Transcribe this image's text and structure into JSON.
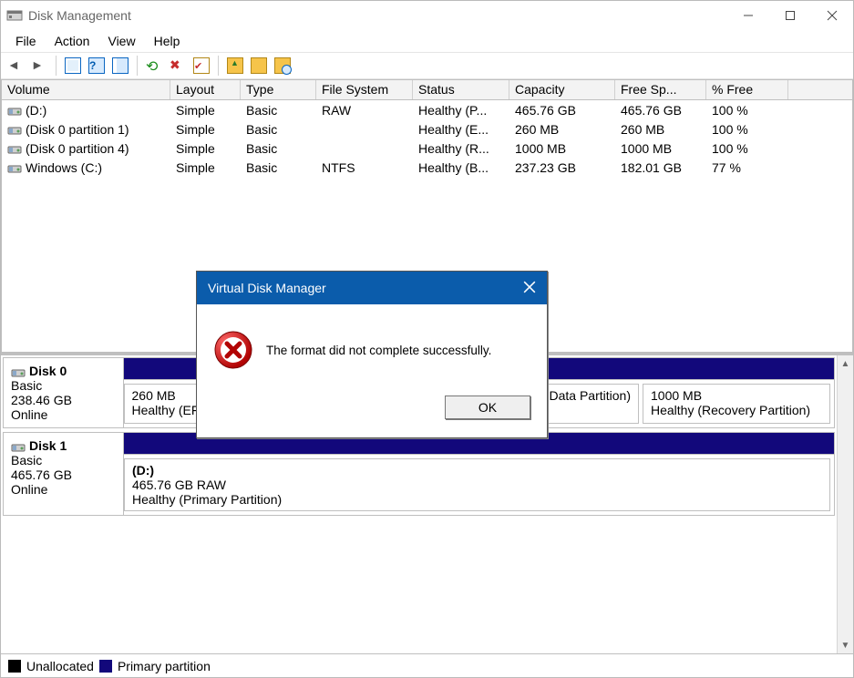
{
  "titlebar": {
    "title": "Disk Management"
  },
  "menu": {
    "items": [
      "File",
      "Action",
      "View",
      "Help"
    ]
  },
  "columns": {
    "volume": "Volume",
    "layout": "Layout",
    "type": "Type",
    "fs": "File System",
    "status": "Status",
    "capacity": "Capacity",
    "free": "Free Sp...",
    "pfree": "% Free"
  },
  "volumes": [
    {
      "name": "(D:)",
      "layout": "Simple",
      "type": "Basic",
      "fs": "RAW",
      "status": "Healthy (P...",
      "capacity": "465.76 GB",
      "free": "465.76 GB",
      "pfree": "100 %"
    },
    {
      "name": "(Disk 0 partition 1)",
      "layout": "Simple",
      "type": "Basic",
      "fs": "",
      "status": "Healthy (E...",
      "capacity": "260 MB",
      "free": "260 MB",
      "pfree": "100 %"
    },
    {
      "name": "(Disk 0 partition 4)",
      "layout": "Simple",
      "type": "Basic",
      "fs": "",
      "status": "Healthy (R...",
      "capacity": "1000 MB",
      "free": "1000 MB",
      "pfree": "100 %"
    },
    {
      "name": "Windows (C:)",
      "layout": "Simple",
      "type": "Basic",
      "fs": "NTFS",
      "status": "Healthy (B...",
      "capacity": "237.23 GB",
      "free": "182.01 GB",
      "pfree": "77 %"
    }
  ],
  "disks": [
    {
      "name": "Disk 0",
      "type": "Basic",
      "size": "238.46 GB",
      "state": "Online",
      "parts": [
        {
          "title": "",
          "line1": "260 MB",
          "line2": "Healthy (EFI System Partition)",
          "flex": "0 0 170px"
        },
        {
          "title": "",
          "line1": "",
          "line2": "Healthy (Boot, Page File, Crash Dump, Basic Data Partition)",
          "flex": "1"
        },
        {
          "title": "",
          "line1": "1000 MB",
          "line2": "Healthy (Recovery Partition)",
          "flex": "0 0 206px"
        }
      ]
    },
    {
      "name": "Disk 1",
      "type": "Basic",
      "size": "465.76 GB",
      "state": "Online",
      "parts": [
        {
          "title": "(D:)",
          "line1": "465.76 GB RAW",
          "line2": "Healthy (Primary Partition)",
          "flex": "1"
        }
      ]
    }
  ],
  "legend": {
    "unallocated": "Unallocated",
    "primary": "Primary partition"
  },
  "dialog": {
    "title": "Virtual Disk Manager",
    "message": "The format did not complete successfully.",
    "ok": "OK"
  }
}
